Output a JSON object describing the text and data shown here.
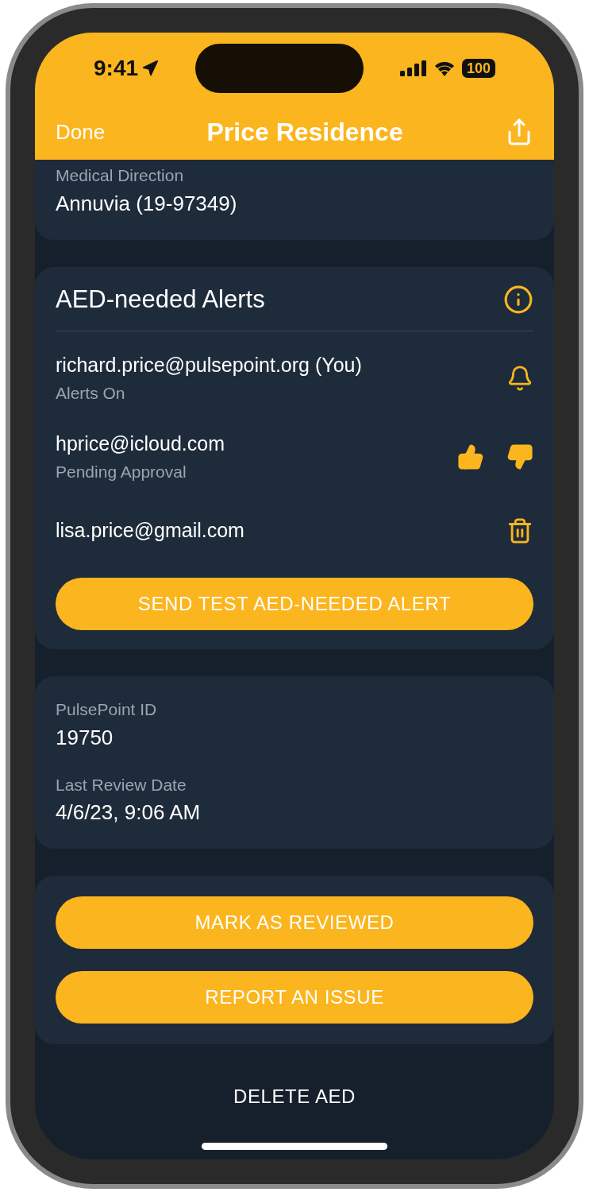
{
  "status_bar": {
    "time": "9:41",
    "battery": "100"
  },
  "nav": {
    "left": "Done",
    "title": "Price Residence"
  },
  "medical_direction": {
    "label": "Medical Direction",
    "value": "Annuvia (19-97349)"
  },
  "alerts": {
    "title": "AED-needed Alerts",
    "members": [
      {
        "email": "richard.price@pulsepoint.org (You)",
        "status": "Alerts On",
        "kind": "alerts_on"
      },
      {
        "email": "hprice@icloud.com",
        "status": "Pending Approval",
        "kind": "pending"
      },
      {
        "email": "lisa.price@gmail.com",
        "kind": "member"
      }
    ],
    "button": "SEND TEST AED-NEEDED ALERT"
  },
  "details": [
    {
      "label": "PulsePoint ID",
      "value": "19750"
    },
    {
      "label": "Last Review Date",
      "value": "4/6/23, 9:06 AM"
    }
  ],
  "actions": [
    "MARK AS REVIEWED",
    "REPORT AN ISSUE"
  ],
  "delete": "DELETE AED"
}
